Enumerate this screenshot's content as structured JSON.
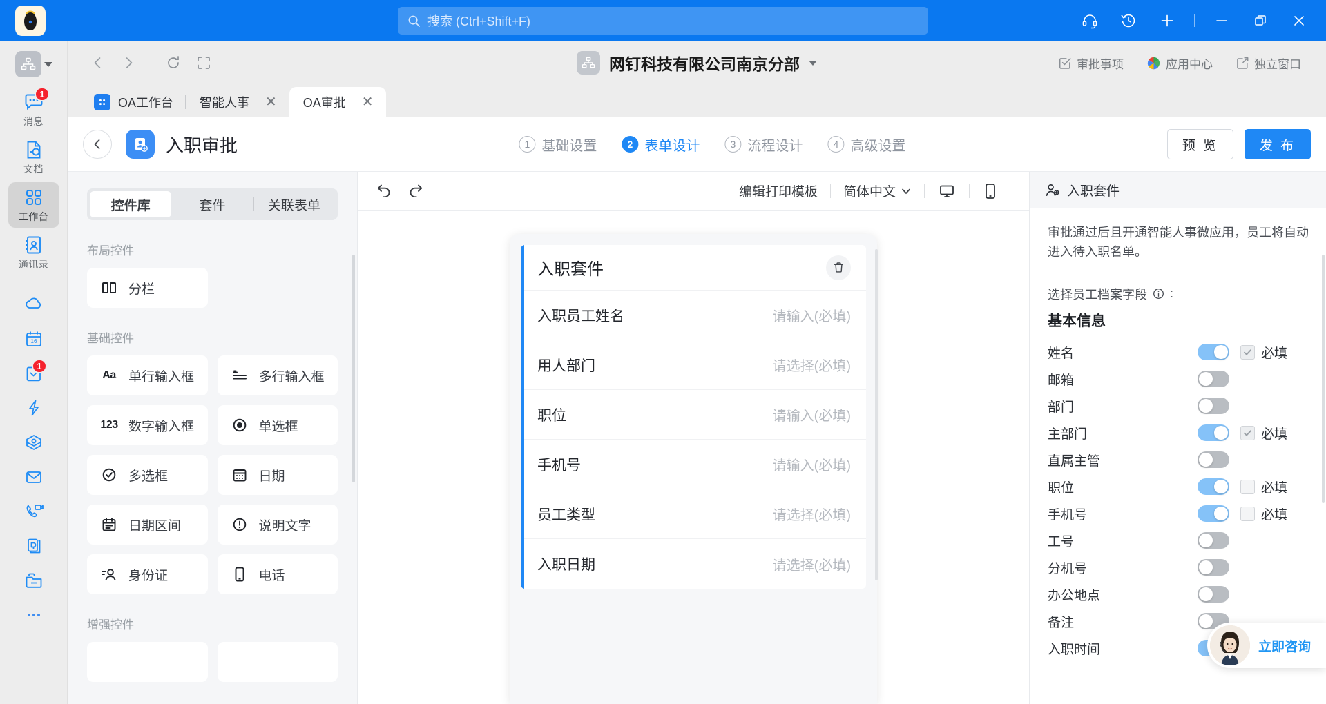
{
  "titlebar": {
    "search_placeholder": "搜索 (Ctrl+Shift+F)",
    "icons": {
      "search": "search-icon",
      "headset": "headset-icon",
      "history": "history-icon",
      "plus": "plus-icon",
      "minimize": "minimize-icon",
      "maximize": "maximize-icon",
      "close": "close-icon"
    },
    "brand_color": "#0a78f0"
  },
  "rail": {
    "org_switcher": "org-switcher",
    "items": [
      {
        "label": "消息",
        "icon": "message-icon",
        "badge": "1",
        "active": false
      },
      {
        "label": "文档",
        "icon": "document-icon",
        "badge": "",
        "active": false
      },
      {
        "label": "工作台",
        "icon": "workbench-icon",
        "badge": "",
        "active": true
      },
      {
        "label": "通讯录",
        "icon": "contacts-icon",
        "badge": "",
        "active": false
      }
    ],
    "mini_items": [
      {
        "icon": "cloud-icon",
        "badge": ""
      },
      {
        "icon": "calendar-16-icon",
        "badge": ""
      },
      {
        "icon": "checklist-icon",
        "badge": "1"
      },
      {
        "icon": "lightning-icon",
        "badge": ""
      },
      {
        "icon": "diamond-icon",
        "badge": ""
      },
      {
        "icon": "mail-icon",
        "badge": ""
      },
      {
        "icon": "phone-video-icon",
        "badge": ""
      },
      {
        "icon": "ding-doc-icon",
        "badge": ""
      },
      {
        "icon": "folder-icon",
        "badge": ""
      },
      {
        "icon": "more-dots-icon",
        "badge": ""
      }
    ]
  },
  "navbar": {
    "back": "back-arrow-icon",
    "forward": "forward-arrow-icon",
    "refresh": "refresh-icon",
    "fullscreen": "fullscreen-icon",
    "org_name": "网钉科技有限公司南京分部",
    "links": [
      {
        "label": "审批事项",
        "icon": "approval-icon"
      },
      {
        "label": "应用中心",
        "icon": "app-center-icon"
      },
      {
        "label": "独立窗口",
        "icon": "detach-window-icon"
      }
    ]
  },
  "tabs": [
    {
      "label": "OA工作台",
      "icon": "grid-app-icon",
      "active": false,
      "closable": false
    },
    {
      "label": "智能人事",
      "icon": "",
      "active": false,
      "closable": true
    },
    {
      "label": "OA审批",
      "icon": "",
      "active": true,
      "closable": true
    }
  ],
  "page": {
    "title": "入职审批",
    "app_icon": "onboarding-app-icon",
    "back_icon": "chevron-left-icon",
    "steps": [
      {
        "num": "1",
        "label": "基础设置",
        "active": false
      },
      {
        "num": "2",
        "label": "表单设计",
        "active": true
      },
      {
        "num": "3",
        "label": "流程设计",
        "active": false
      },
      {
        "num": "4",
        "label": "高级设置",
        "active": false
      }
    ],
    "preview_label": "预 览",
    "publish_label": "发 布",
    "accent_color": "#1f88f5"
  },
  "library": {
    "tabs": [
      {
        "label": "控件库",
        "active": true
      },
      {
        "label": "套件",
        "active": false
      },
      {
        "label": "关联表单",
        "active": false
      }
    ],
    "groups": [
      {
        "title": "布局控件",
        "items": [
          {
            "label": "分栏",
            "icon": "columns-icon"
          }
        ]
      },
      {
        "title": "基础控件",
        "items": [
          {
            "label": "单行输入框",
            "icon": "text-aa-icon"
          },
          {
            "label": "多行输入框",
            "icon": "textarea-icon"
          },
          {
            "label": "数字输入框",
            "icon": "number-123-icon"
          },
          {
            "label": "单选框",
            "icon": "radio-icon"
          },
          {
            "label": "多选框",
            "icon": "check-circle-icon"
          },
          {
            "label": "日期",
            "icon": "calendar-icon"
          },
          {
            "label": "日期区间",
            "icon": "date-range-icon"
          },
          {
            "label": "说明文字",
            "icon": "info-exclaim-icon"
          },
          {
            "label": "身份证",
            "icon": "id-card-icon"
          },
          {
            "label": "电话",
            "icon": "mobile-phone-icon"
          }
        ]
      },
      {
        "title": "增强控件",
        "items": []
      }
    ]
  },
  "canvas": {
    "undo": "undo-icon",
    "redo": "redo-icon",
    "print_template_label": "编辑打印模板",
    "language_label": "简体中文",
    "desktop_icon": "desktop-icon",
    "mobile_icon": "mobile-icon",
    "form": {
      "title": "入职套件",
      "delete_icon": "trash-icon",
      "rows": [
        {
          "label": "入职员工姓名",
          "placeholder": "请输入(必填)"
        },
        {
          "label": "用人部门",
          "placeholder": "请选择(必填)"
        },
        {
          "label": "职位",
          "placeholder": "请输入(必填)"
        },
        {
          "label": "手机号",
          "placeholder": "请输入(必填)"
        },
        {
          "label": "员工类型",
          "placeholder": "请选择(必填)"
        },
        {
          "label": "入职日期",
          "placeholder": "请选择(必填)"
        }
      ]
    }
  },
  "rpanel": {
    "header": "入职套件",
    "header_icon": "person-add-icon",
    "description": "审批通过后且开通智能人事微应用，员工将自动进入待入职名单。",
    "select_label": "选择员工档案字段",
    "info_icon": "info-icon",
    "group_title": "基本信息",
    "required_label": "必填",
    "fields": [
      {
        "name": "姓名",
        "enabled": true,
        "required": true,
        "show_required": true
      },
      {
        "name": "邮箱",
        "enabled": false,
        "required": false,
        "show_required": false
      },
      {
        "name": "部门",
        "enabled": false,
        "required": false,
        "show_required": false
      },
      {
        "name": "主部门",
        "enabled": true,
        "required": true,
        "show_required": true
      },
      {
        "name": "直属主管",
        "enabled": false,
        "required": false,
        "show_required": false
      },
      {
        "name": "职位",
        "enabled": true,
        "required": false,
        "show_required": true
      },
      {
        "name": "手机号",
        "enabled": true,
        "required": false,
        "show_required": true
      },
      {
        "name": "工号",
        "enabled": false,
        "required": false,
        "show_required": false
      },
      {
        "name": "分机号",
        "enabled": false,
        "required": false,
        "show_required": false
      },
      {
        "name": "办公地点",
        "enabled": false,
        "required": false,
        "show_required": false
      },
      {
        "name": "备注",
        "enabled": false,
        "required": false,
        "show_required": false
      },
      {
        "name": "入职时间",
        "enabled": true,
        "required": false,
        "show_required": true
      }
    ]
  },
  "chat": {
    "label": "立即咨询",
    "avatar": "support-agent-avatar"
  }
}
